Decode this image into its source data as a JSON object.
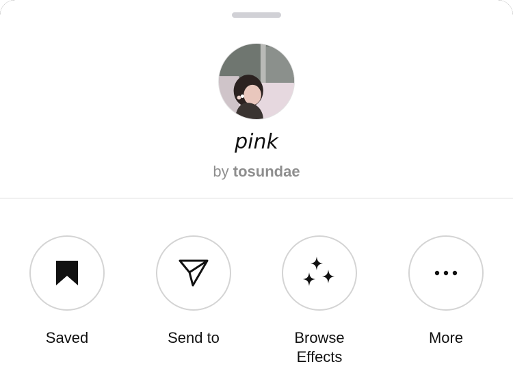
{
  "effect": {
    "name": "pink",
    "byline_prefix": "by",
    "author": "tosundae"
  },
  "actions": [
    {
      "label": "Saved",
      "icon": "bookmark-filled-icon"
    },
    {
      "label": "Send to",
      "icon": "paper-plane-icon"
    },
    {
      "label": "Browse\nEffects",
      "icon": "sparkles-icon"
    },
    {
      "label": "More",
      "icon": "ellipsis-icon"
    }
  ],
  "colors": {
    "sheet": "#ffffff",
    "secondary_text": "#8e8e8e",
    "circle_border": "#d4d4d4",
    "divider": "#dbdbdb",
    "grabber": "#d1d1d6"
  }
}
